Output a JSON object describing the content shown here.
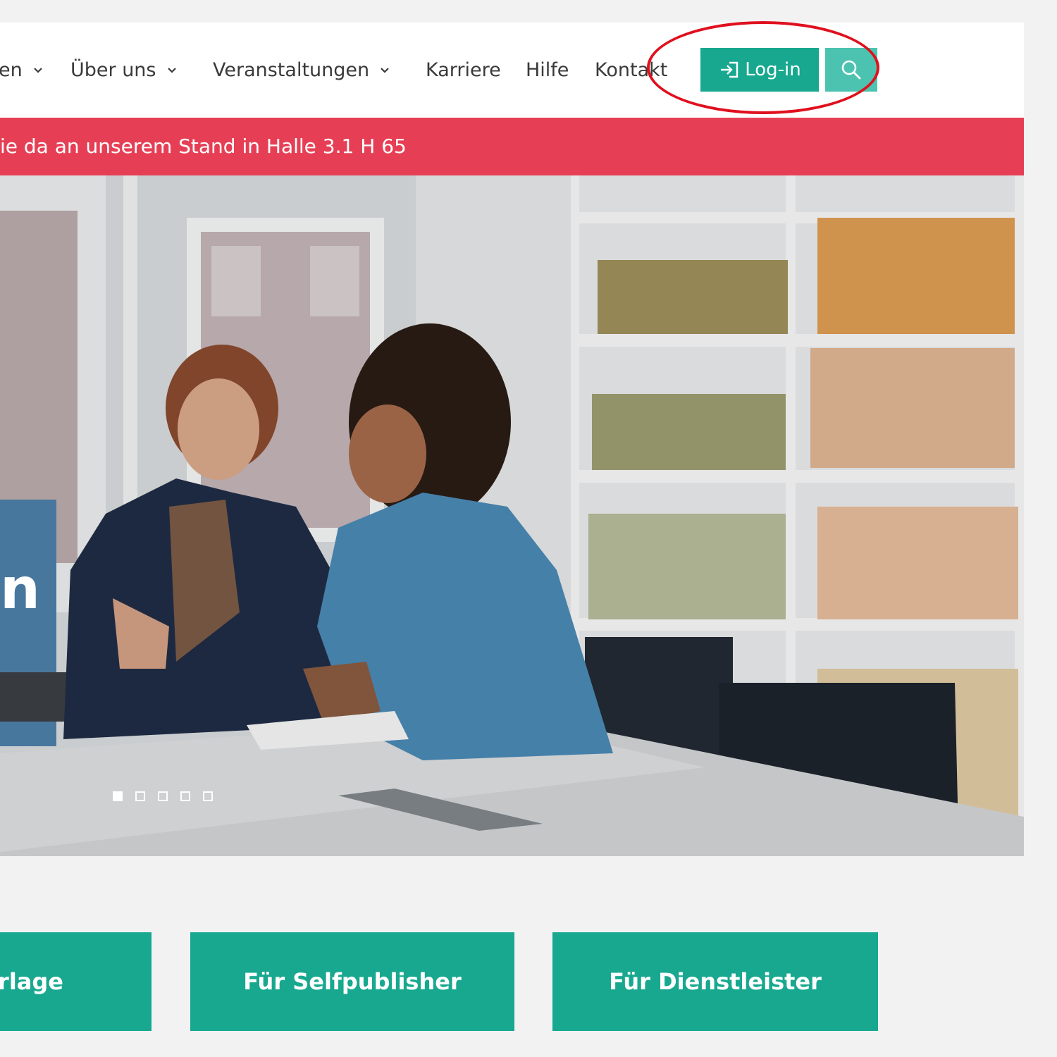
{
  "nav": {
    "items": [
      {
        "label": "en"
      },
      {
        "label": "Über uns"
      },
      {
        "label": "Veranstaltungen"
      },
      {
        "label": "Karriere"
      },
      {
        "label": "Hilfe"
      },
      {
        "label": "Kontakt"
      }
    ],
    "login_label": "Log-in"
  },
  "banner": {
    "text": "ie da an unserem Stand in Halle 3.1 H 65"
  },
  "hero": {
    "heading": "n",
    "slides_total": 5,
    "active_slide": 1
  },
  "cards": [
    {
      "label": "rlage"
    },
    {
      "label": "Für Selfpublisher"
    },
    {
      "label": "Für Dienstleister"
    }
  ],
  "colors": {
    "accent": "#17a88f",
    "search_button": "#4cc3b0",
    "banner": "#e63f55",
    "highlight": "#e0101e"
  },
  "icons": {
    "login": "login-arrow-icon",
    "search": "search-icon",
    "dropdown": "chevron-down-icon"
  }
}
